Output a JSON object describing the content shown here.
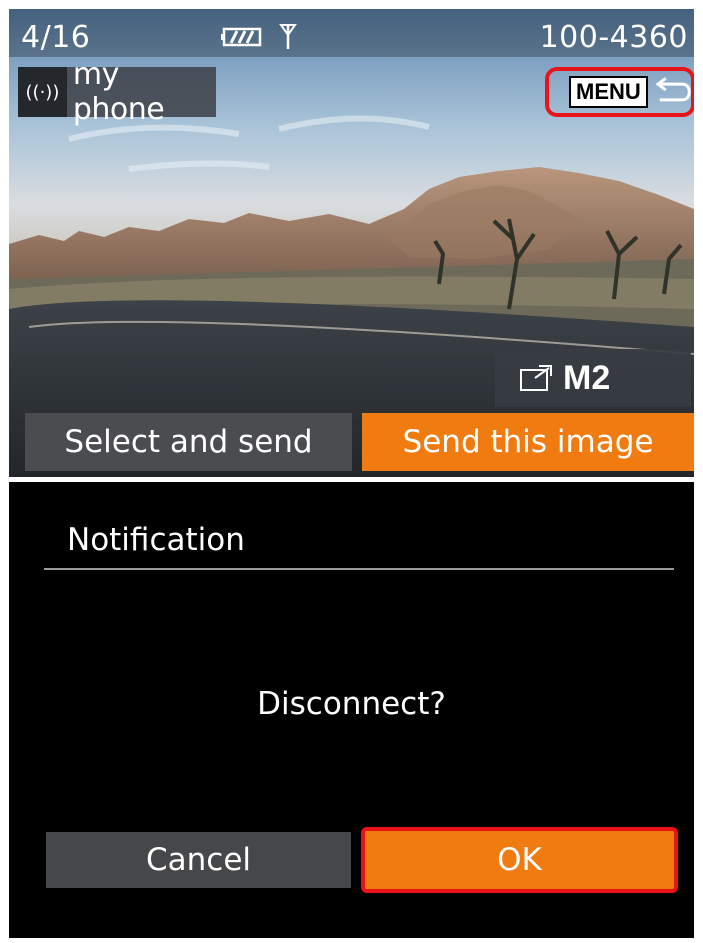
{
  "top_screen": {
    "image_counter": "4/16",
    "file_number": "100-4360",
    "connection": {
      "icon": "wifi-broadcast-icon",
      "label": "my phone"
    },
    "menu_button": {
      "label": "MENU",
      "icon": "return-arrow-icon"
    },
    "shooting_mode": {
      "icon": "mode-dial-icon",
      "label": "M2"
    },
    "buttons": {
      "select_and_send": "Select and send",
      "send_this_image": "Send this image"
    },
    "status_icons": [
      "battery-icon",
      "antenna-icon"
    ]
  },
  "bottom_screen": {
    "title": "Notification",
    "message": "Disconnect?",
    "buttons": {
      "cancel": "Cancel",
      "ok": "OK"
    }
  },
  "colors": {
    "accent_orange": "#f07b10",
    "highlight_red": "#e8141c",
    "button_gray": "#4a4c4f",
    "background_black": "#000000"
  }
}
